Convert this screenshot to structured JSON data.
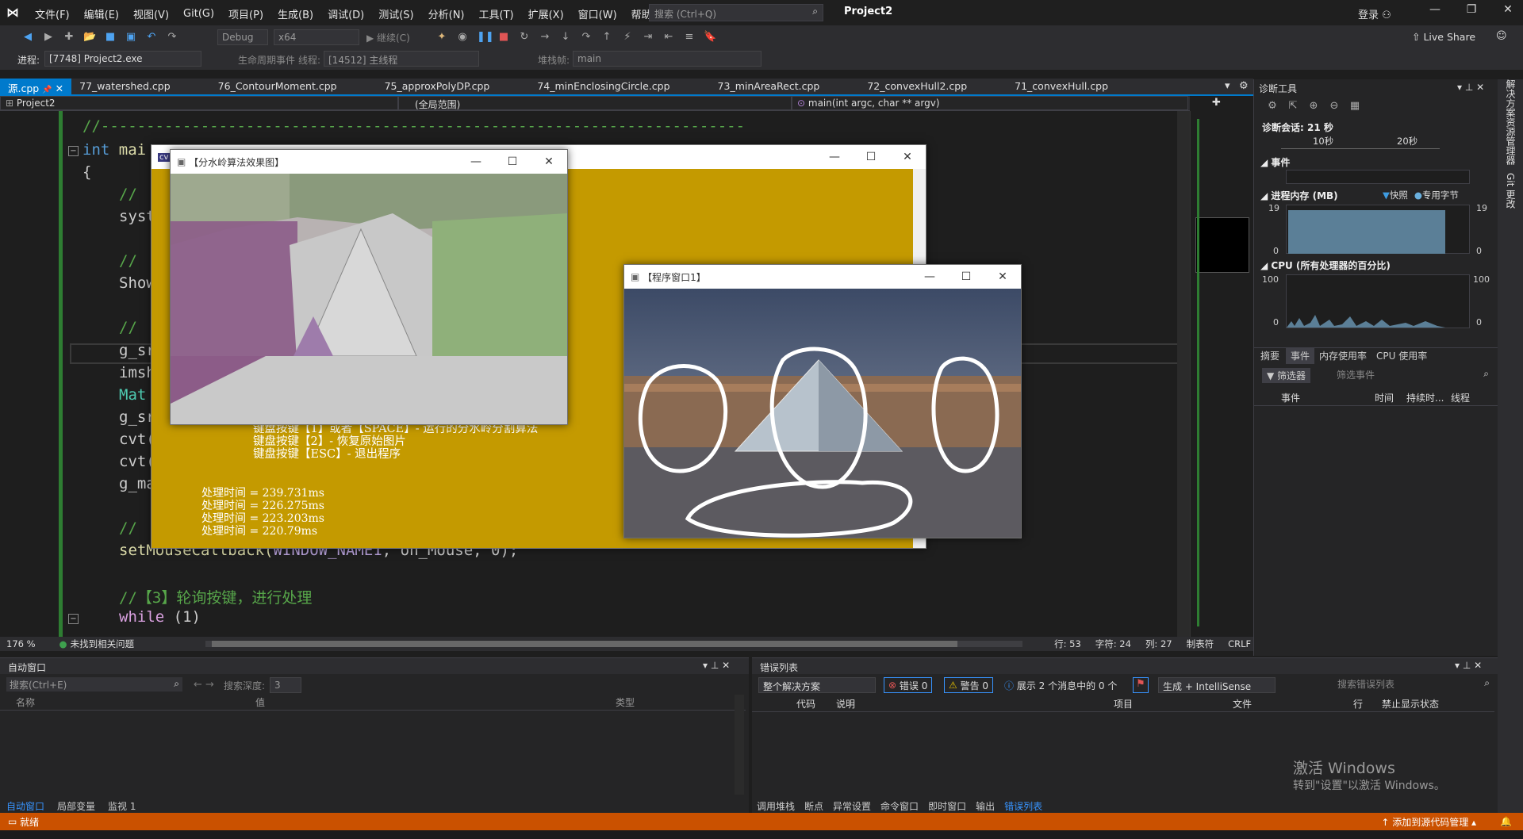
{
  "title_bar": {
    "menu": [
      "文件(F)",
      "编辑(E)",
      "视图(V)",
      "Git(G)",
      "项目(P)",
      "生成(B)",
      "调试(D)",
      "测试(S)",
      "分析(N)",
      "工具(T)",
      "扩展(X)",
      "窗口(W)",
      "帮助(H)"
    ],
    "search_placeholder": "搜索 (Ctrl+Q)",
    "project": "Project2",
    "login": "登录",
    "live_share": "Live Share"
  },
  "toolbar": {
    "config": "Debug",
    "platform": "x64",
    "continue": "继续(C)",
    "process_label": "进程:",
    "process": "[7748] Project2.exe",
    "lifecycle": "生命周期事件",
    "thread_label": "线程:",
    "thread": "[14512] 主线程",
    "stack_label": "堆栈帧:",
    "stack": "main"
  },
  "tabs": [
    {
      "label": "源.cpp",
      "active": true
    },
    {
      "label": "77_watershed.cpp"
    },
    {
      "label": "76_ContourMoment.cpp"
    },
    {
      "label": "75_approxPolyDP.cpp"
    },
    {
      "label": "74_minEnclosingCircle.cpp"
    },
    {
      "label": "73_minAreaRect.cpp"
    },
    {
      "label": "72_convexHull2.cpp"
    },
    {
      "label": "71_convexHull.cpp"
    }
  ],
  "nav": {
    "project": "Project2",
    "scope": "(全局范围)",
    "func": "main(int argc, char ** argv)"
  },
  "code": {
    "l1": "//-----------------------------------------------------------------------",
    "l2a": "int ",
    "l2b": "mai",
    "l3": "{",
    "l4": "// ",
    "l5": "syst",
    "l6": "// ",
    "l7": "Show",
    "l8": "// ",
    "l9": "g_sr",
    "l10": "imsh",
    "l11": "Mat",
    "l12": "g_sr",
    "l13": "cvt(",
    "l14": "cvt(",
    "l15": "g_ma",
    "l16": "// ",
    "l17a": "setMouseCallback(",
    "l17b": "WINDOW_NAME1",
    "l17c": ", on_Mouse, 0);",
    "l18": "//【3】轮询按键，进行处理",
    "l19a": "while",
    " l19b": "(1)",
    "l19b": " (1)"
  },
  "editor_status": {
    "zoom": "176 %",
    "issues": "未找到相关问题",
    "line": "行: 53",
    "char": "字符: 24",
    "col": "列: 27",
    "tabs": "制表符",
    "eol": "CRLF"
  },
  "diag": {
    "title": "诊断工具",
    "session": "诊断会话: 21 秒",
    "t10": "10秒",
    "t20": "20秒",
    "events": "事件",
    "memory": "进程内存 (MB)",
    "snapshot": "快照",
    "private": "专用字节",
    "mem_max": "19",
    "mem_min": "0",
    "cpu": "CPU (所有处理器的百分比)",
    "cpu_max": "100",
    "cpu_min": "0",
    "tabs": [
      "摘要",
      "事件",
      "内存使用率",
      "CPU 使用率"
    ],
    "filter": "筛选器",
    "filter_ph": "筛选事件",
    "cols": [
      "事件",
      "时间",
      "持续时...",
      "线程"
    ]
  },
  "right_strip": [
    "解决方案资源管理器",
    "Git 更改"
  ],
  "autos": {
    "title": "自动窗口",
    "search_ph": "搜索(Ctrl+E)",
    "depth_label": "搜索深度:",
    "depth": "3",
    "cols": [
      "名称",
      "值",
      "类型"
    ],
    "tabs": [
      "自动窗口",
      "局部变量",
      "监视 1"
    ]
  },
  "errors": {
    "title": "错误列表",
    "scope": "整个解决方案",
    "err": "错误 0",
    "warn": "警告 0",
    "msg": "展示 2 个消息中的 0 个",
    "build": "生成 + IntelliSense",
    "search_ph": "搜索错误列表",
    "cols": [
      "代码",
      "说明",
      "项目",
      "文件",
      "行",
      "禁止显示状态"
    ],
    "tabs": [
      "调用堆栈",
      "断点",
      "异常设置",
      "命令窗口",
      "即时窗口",
      "输出",
      "错误列表"
    ]
  },
  "activate": {
    "line1": "激活 Windows",
    "line2": "转到\"设置\"以激活 Windows。"
  },
  "status": {
    "ready": "就绪",
    "source": "添加到源代码管理"
  },
  "win_console": {
    "lines": [
      "键盘按键【1】或者【SPACE】- 运行的分水岭分割算法",
      "键盘按键【2】- 恢复原始图片",
      "键盘按键【ESC】- 退出程序"
    ],
    "times": [
      "处理时间 = 239.731ms",
      "处理时间 = 226.275ms",
      "处理时间 = 223.203ms",
      "处理时间 = 220.79ms"
    ]
  },
  "win_watershed": {
    "title": "【分水岭算法效果图】"
  },
  "win_program": {
    "title": "【程序窗口1】"
  },
  "colors": {
    "accent": "#007acc",
    "status": "#ca5100",
    "console_bg": "#c49a00"
  }
}
